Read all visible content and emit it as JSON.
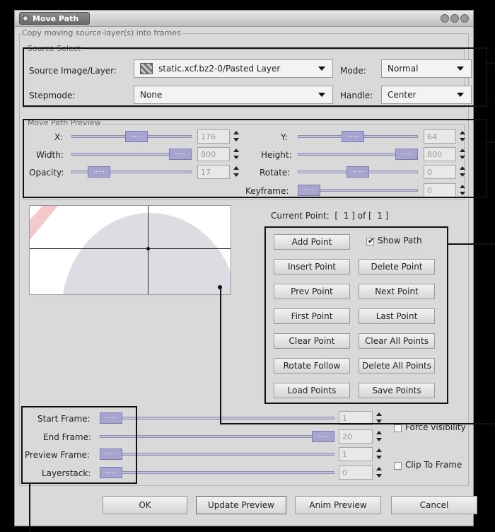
{
  "window": {
    "title": "Move Path"
  },
  "main_group": {
    "legend": "Copy moving source-layer(s) into frames"
  },
  "source_select": {
    "legend": "Source Select",
    "source_label": "Source Image/Layer:",
    "source_value": "static.xcf.bz2-0/Pasted Layer",
    "mode_label": "Mode:",
    "mode_value": "Normal",
    "stepmode_label": "Stepmode:",
    "stepmode_value": "None",
    "handle_label": "Handle:",
    "handle_value": "Center"
  },
  "preview_group": {
    "legend": "Move Path Preview",
    "x": {
      "label": "X:",
      "value": "176",
      "level": 0.55
    },
    "y": {
      "label": "Y:",
      "value": "64",
      "level": 0.45
    },
    "width": {
      "label": "Width:",
      "value": "800",
      "level": 1.0
    },
    "height": {
      "label": "Height:",
      "value": "800",
      "level": 1.0
    },
    "opacity": {
      "label": "Opacity:",
      "value": "17",
      "level": 0.17
    },
    "rotate": {
      "label": "Rotate:",
      "value": "0",
      "level": 0.5
    },
    "keyframe": {
      "label": "Keyframe:",
      "value": "0",
      "level": 0.0
    }
  },
  "current_point": {
    "label": "Current Point:",
    "of_label": "of",
    "index": "1",
    "total": "1"
  },
  "point_buttons": {
    "add": "Add Point",
    "show_path": "Show Path",
    "insert": "Insert Point",
    "delete": "Delete Point",
    "prev": "Prev Point",
    "next": "Next Point",
    "first": "First Point",
    "last": "Last Point",
    "clear": "Clear Point",
    "clear_all": "Clear All Points",
    "rotate_follow": "Rotate Follow",
    "delete_all": "Delete All Points",
    "load": "Load Points",
    "save": "Save Points"
  },
  "show_path_checked": true,
  "frames": {
    "start": {
      "label": "Start Frame:",
      "value": "1",
      "level": 0.0
    },
    "end": {
      "label": "End Frame:",
      "value": "20",
      "level": 1.0
    },
    "preview": {
      "label": "Preview Frame:",
      "value": "1",
      "level": 0.0
    },
    "layerstack": {
      "label": "Layerstack:",
      "value": "0",
      "level": 0.0
    }
  },
  "force_visibility": {
    "label": "Force visibility",
    "checked": false
  },
  "clip_to_frame": {
    "label": "Clip To Frame",
    "checked": false
  },
  "actions": {
    "ok": "OK",
    "update_preview": "Update Preview",
    "anim_preview": "Anim Preview",
    "cancel": "Cancel"
  },
  "colors": {
    "slider_track": "#c4c3dc",
    "slider_thumb": "#a6a5cf",
    "window_bg": "#d9d9d9",
    "annotation": "#111111"
  }
}
